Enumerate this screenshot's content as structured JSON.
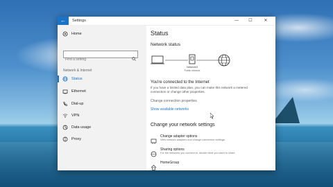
{
  "window": {
    "title": "Settings",
    "controls": {
      "minimize": "—",
      "maximize": "☐",
      "close": "✕"
    }
  },
  "sidebar": {
    "home": "Home",
    "search_placeholder": "Find a setting",
    "section": "Network & Internet",
    "items": [
      {
        "label": "Status",
        "icon": "globe-icon",
        "active": true
      },
      {
        "label": "Ethernet",
        "icon": "ethernet-icon",
        "active": false
      },
      {
        "label": "Dial-up",
        "icon": "phone-icon",
        "active": false
      },
      {
        "label": "VPN",
        "icon": "vpn-icon",
        "active": false
      },
      {
        "label": "Data usage",
        "icon": "data-usage-icon",
        "active": false
      },
      {
        "label": "Proxy",
        "icon": "proxy-icon",
        "active": false
      }
    ]
  },
  "main": {
    "title": "Status",
    "network_status_heading": "Network status",
    "diagram": {
      "network_name": "Network3",
      "network_type": "Public network"
    },
    "connected_text": "You're connected to the Internet",
    "info_text": "If you have a limited data plan, you can make this network a metered connection or change other properties.",
    "change_connection_link": "Change connection properties",
    "show_networks_link": "Show available networks",
    "change_settings_heading": "Change your network settings",
    "options": [
      {
        "title": "Change adapter options",
        "desc": "View network adapters and change connection settings.",
        "icon": "adapter-icon"
      },
      {
        "title": "Sharing options",
        "desc": "For the networks you connect to, decide what you want to share.",
        "icon": "sharing-icon"
      },
      {
        "title": "HomeGroup",
        "desc": "",
        "icon": "homegroup-icon"
      }
    ]
  },
  "colors": {
    "accent": "#1a73c6",
    "sidebar_bg": "#f2f2f2",
    "window_bg": "#ffffff"
  }
}
